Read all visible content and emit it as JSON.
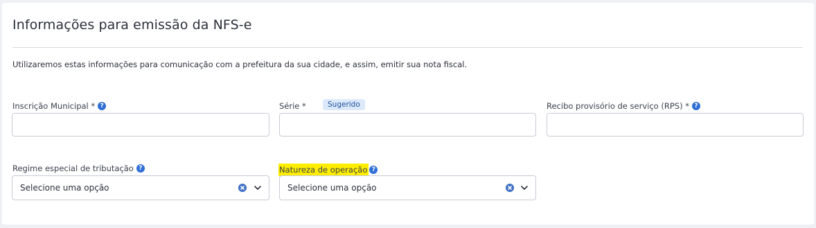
{
  "section": {
    "title": "Informações para emissão da NFS-e",
    "description": "Utilizaremos estas informações para comunicação com a prefeitura da sua cidade, e assim, emitir sua nota fiscal."
  },
  "fields": {
    "inscricao_municipal": {
      "label": "Inscrição Municipal *",
      "value": ""
    },
    "serie": {
      "label": "Série *",
      "badge": "Sugerido",
      "value": ""
    },
    "rps": {
      "label": "Recibo provisório de serviço (RPS) *",
      "value": ""
    },
    "regime": {
      "label": "Regime especial de tributação",
      "selected": "Selecione uma opção"
    },
    "natureza": {
      "label": "Natureza de operação",
      "selected": "Selecione uma opção"
    }
  },
  "help_glyph": "?",
  "icons": {
    "help": "question-circle-icon",
    "clear": "clear-x-icon",
    "dropdown": "chevron-down-icon"
  },
  "colors": {
    "help_icon": "#2f6fd6",
    "badge_bg": "#dbe9fb",
    "highlight": "#ffee00",
    "clear_icon": "#3d6fc4"
  }
}
